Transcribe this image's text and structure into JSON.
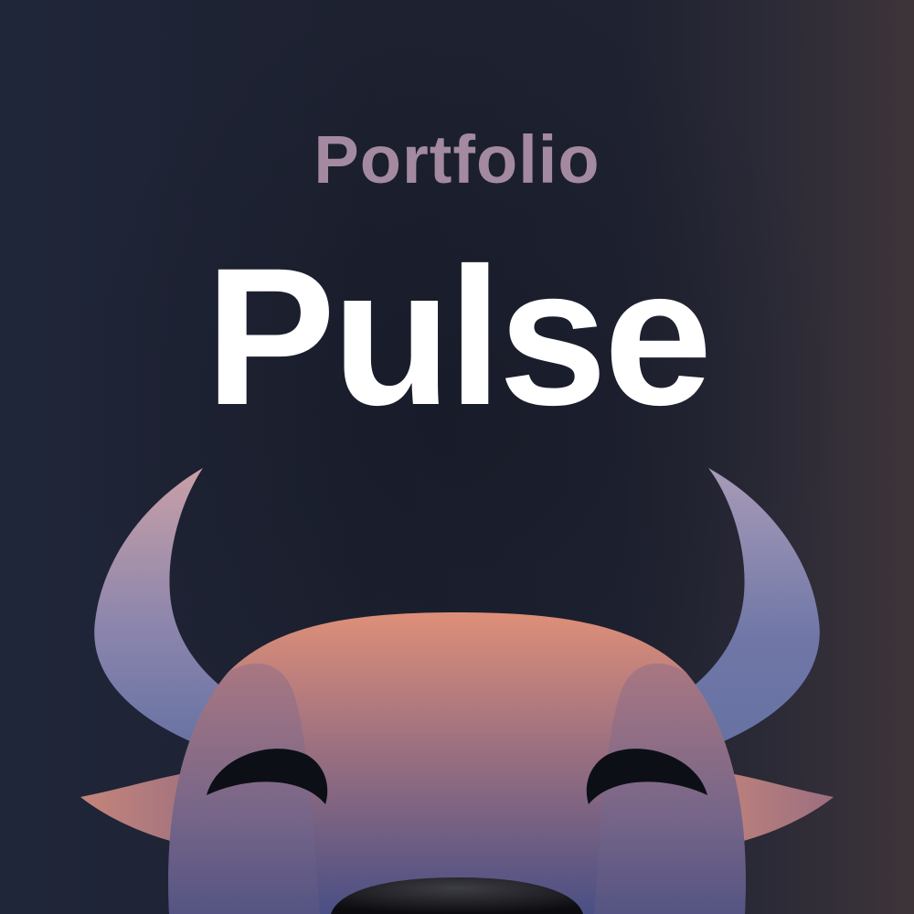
{
  "logo": {
    "line1": "Portfolio",
    "line2": "Pulse"
  },
  "colors": {
    "background": "#1d2130",
    "title_small": "#a38aa0",
    "title_big": "#ffffff",
    "face_top": "#d98a74",
    "face_bottom": "#4a4f85",
    "horn_top": "#c9a0a6",
    "horn_bottom": "#6672a3"
  },
  "icons": {
    "mascot": "bull-head-icon"
  }
}
